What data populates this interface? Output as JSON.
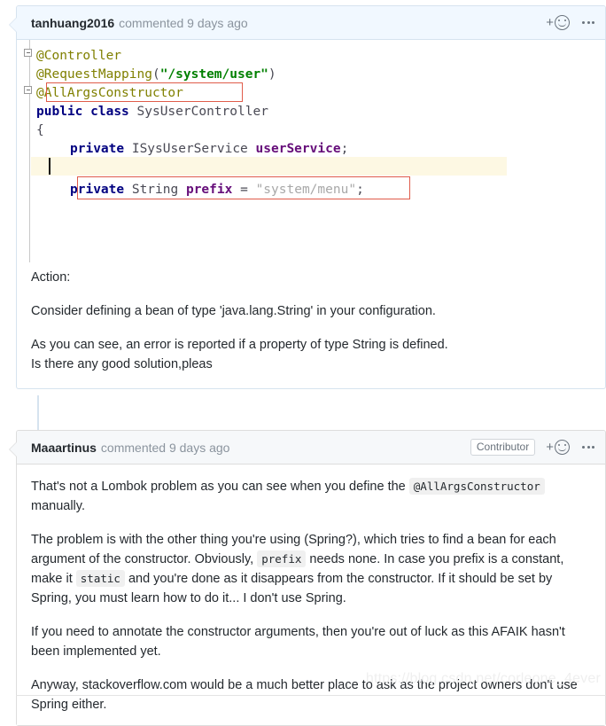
{
  "comments": [
    {
      "author": "tanhuang2016",
      "meta": "commented 9 days ago",
      "badge": null,
      "add_reaction_label": "+",
      "reaction_icon": "smiley-icon",
      "menu_icon": "kebab-menu-icon"
    },
    {
      "author": "Maaartinus",
      "meta": "commented 9 days ago",
      "badge": "Contributor",
      "add_reaction_label": "+",
      "reaction_icon": "smiley-icon",
      "menu_icon": "kebab-menu-icon"
    }
  ],
  "code": {
    "language": "java",
    "lines": [
      "@Controller",
      "@RequestMapping(\"/system/user\")",
      "@AllArgsConstructor",
      "public class SysUserController",
      "{",
      "    private ISysUserService userService;",
      "",
      "    private String prefix = \"system/menu\";"
    ],
    "tokens": {
      "annotation_controller": "@Controller",
      "annotation_requestmapping": "@RequestMapping",
      "annotation_allargsconstructor": "@AllArgsConstructor",
      "string_mapping": "\"/system/user\"",
      "keyword_public": "public",
      "keyword_class": "class",
      "class_name": "SysUserController",
      "brace_open": "{",
      "keyword_private": "private",
      "type_isysuserservice": "ISysUserService",
      "field_userservice": "userService",
      "type_string": "String",
      "field_prefix": "prefix",
      "operator_equals": "=",
      "string_prefix_value": "\"system/menu\"",
      "semicolon": ";",
      "paren_open": "(",
      "paren_close": ")"
    },
    "highlight_boxes": [
      "@AllArgsConstructor",
      "private String prefix = \"system/menu\";"
    ],
    "current_line_index": 6
  },
  "comment1_body": {
    "p1": "Action:",
    "p2": "Consider defining a bean of type 'java.lang.String' in your configuration.",
    "p3_line1": "As you can see, an error is reported if a property of type String is defined.",
    "p3_line2": "Is there any good solution,pleas"
  },
  "comment2_body": {
    "p1_a": "That's not a Lombok problem as you can see when you define the ",
    "p1_code": "@AllArgsConstructor",
    "p1_b": " manually.",
    "p2_a": "The problem is with the other thing you're using (Spring?), which tries to find a bean for each argument of the constructor. Obviously, ",
    "p2_code1": "prefix",
    "p2_b": " needs none. In case you prefix is a constant, make it ",
    "p2_code2": "static",
    "p2_c": " and you're done as it disappears from the constructor. If it should be set by Spring, you must learn how to do it... I don't use Spring.",
    "p3": "If you need to annotate the constructor arguments, then you're out of luck as this AFAIK hasn't been implemented yet.",
    "p4": "Anyway, stackoverflow.com would be a much better place to ask as the project owners don't use Spring either."
  },
  "watermark": "https://blog.csdn.net/corleone_4ever",
  "colors": {
    "header_blue_bg": "#f1f8ff",
    "header_blue_border": "#d6e3ef",
    "header_gray_bg": "#f6f8fa",
    "header_gray_border": "#dddddd",
    "annotation": "#808000",
    "keyword": "#000080",
    "field": "#660e7a",
    "string": "#008000",
    "highlight_box": "#e05c4a",
    "current_line": "#fdf8e3",
    "text": "#24292e",
    "muted": "#8b949e"
  }
}
